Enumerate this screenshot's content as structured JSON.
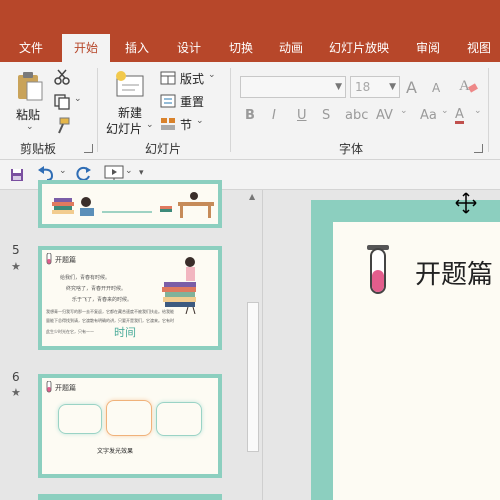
{
  "menu": {
    "tabs": [
      {
        "label": "文件",
        "active": false
      },
      {
        "label": "开始",
        "active": true
      },
      {
        "label": "插入",
        "active": false
      },
      {
        "label": "设计",
        "active": false
      },
      {
        "label": "切换",
        "active": false
      },
      {
        "label": "动画",
        "active": false
      },
      {
        "label": "幻灯片放映",
        "active": false
      },
      {
        "label": "审阅",
        "active": false
      },
      {
        "label": "视图",
        "active": false
      }
    ]
  },
  "ribbon": {
    "clipboard": {
      "group_label": "剪贴板",
      "paste_label": "粘贴"
    },
    "slides": {
      "group_label": "幻灯片",
      "new_slide_line1": "新建",
      "new_slide_line2": "幻灯片",
      "layout_label": "版式",
      "reset_label": "重置",
      "section_label": "节"
    },
    "font": {
      "group_label": "字体",
      "font_name_value": "",
      "font_size_value": "18",
      "bold": "B",
      "italic": "I",
      "underline": "U",
      "strikethrough": "S",
      "spacing": "AV",
      "case": "Aa",
      "grow": "A",
      "shrink": "A",
      "color": "A"
    }
  },
  "slides": [
    {
      "number": "5",
      "title": "开题篇",
      "lines": [
        "给我们，青春有时候。",
        "终究啥了，青春开开时候。",
        "乐于飞了，青春来的时候。",
        "我想青一归我写的那一去不复返，它都在藏合速度不被我们扶走。给我能",
        "量能下总得找到请，它渡散有明确的讲，只要开是我们，它渡来。它有时",
        "此生少时光在它，只有——"
      ],
      "highlight": "时间",
      "active": true
    },
    {
      "number": "6",
      "title": "开题篇",
      "caption": "文字发光效果",
      "active": false
    }
  ],
  "main_slide": {
    "title": "开题篇"
  }
}
